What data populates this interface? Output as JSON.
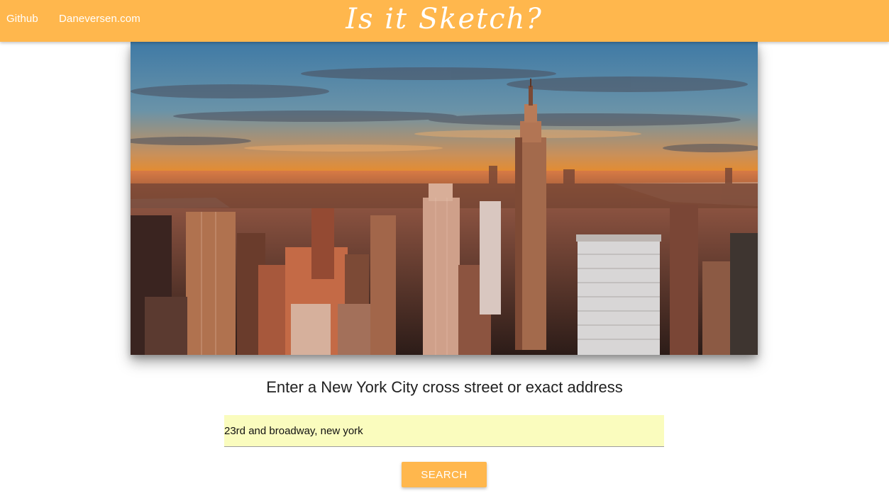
{
  "nav": {
    "links": [
      "Github",
      "Daneversen.com"
    ],
    "brand": "Is it Sketch?",
    "color": "#ffb74d"
  },
  "hero": {
    "image_description_icon": "city-skyline-photo"
  },
  "form": {
    "prompt": "Enter a New York City cross street or exact address",
    "address_value": "23rd and broadway, new york",
    "input_bg": "#fafcbe",
    "search_label": "SEARCH"
  }
}
